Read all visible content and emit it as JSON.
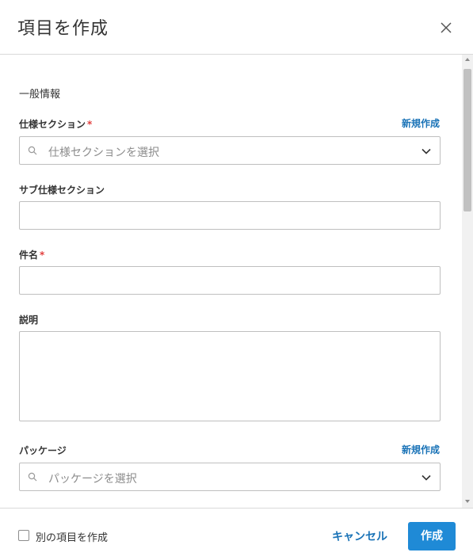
{
  "dialog": {
    "title": "項目を作成"
  },
  "form": {
    "section_title": "一般情報",
    "spec_section": {
      "label": "仕様セクション",
      "required_mark": "*",
      "new_link": "新規作成",
      "placeholder": "仕様セクションを選択"
    },
    "sub_spec_section": {
      "label": "サブ仕様セクション",
      "value": ""
    },
    "subject": {
      "label": "件名",
      "required_mark": "*",
      "value": ""
    },
    "description": {
      "label": "説明",
      "value": ""
    },
    "package": {
      "label": "パッケージ",
      "new_link": "新規作成",
      "placeholder": "パッケージを選択"
    }
  },
  "footer": {
    "create_another_label": "別の項目を作成",
    "create_another_checked": false,
    "cancel_label": "キャンセル",
    "create_label": "作成"
  },
  "colors": {
    "link": "#1a73b7",
    "primary_button": "#1f8ad6",
    "required": "#e2403f"
  }
}
